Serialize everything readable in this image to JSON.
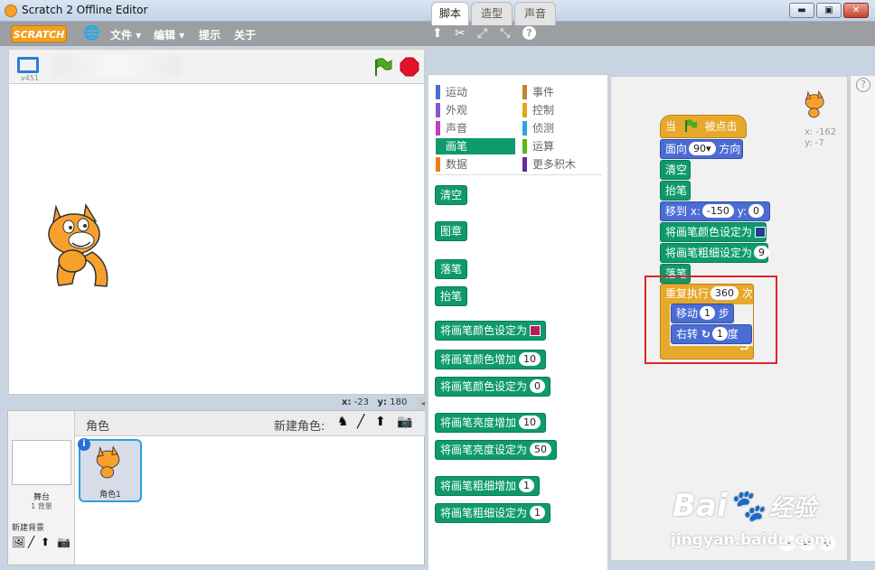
{
  "window": {
    "title": "Scratch 2 Offline Editor",
    "min": "▬",
    "max": "▣",
    "close": "✕"
  },
  "menu": {
    "logo": "SCRATCH",
    "file": "文件 ▾",
    "edit": "编辑 ▾",
    "tips": "提示",
    "about": "关于"
  },
  "toolbar": {
    "icons": [
      "duplicate-icon",
      "delete-icon",
      "grow-icon",
      "shrink-icon",
      "help-icon"
    ]
  },
  "stage": {
    "version": "v451",
    "coords_x_label": "x:",
    "coords_x": "-23",
    "coords_y_label": "y:",
    "coords_y": "180"
  },
  "sprites": {
    "header": "角色",
    "new_sprite": "新建角色:",
    "stage_label": "舞台",
    "stage_sub": "1 背景",
    "new_backdrop": "新建背景",
    "sprite1": "角色1",
    "info": "i"
  },
  "tabs": {
    "scripts": "脚本",
    "costumes": "造型",
    "sounds": "声音"
  },
  "categories": [
    {
      "label": "运动",
      "color": "#4a6cd4"
    },
    {
      "label": "事件",
      "color": "#c88330"
    },
    {
      "label": "外观",
      "color": "#8a55d7"
    },
    {
      "label": "控制",
      "color": "#e1a91a"
    },
    {
      "label": "声音",
      "color": "#bb42c3"
    },
    {
      "label": "侦测",
      "color": "#2ca5e2"
    },
    {
      "label": "画笔",
      "color": "#0e9a6c"
    },
    {
      "label": "运算",
      "color": "#5cb712"
    },
    {
      "label": "数据",
      "color": "#ee7d16"
    },
    {
      "label": "更多积木",
      "color": "#632d99"
    }
  ],
  "palette": [
    {
      "label": "清空"
    },
    {
      "label": "图章"
    },
    {
      "label": "落笔"
    },
    {
      "label": "抬笔"
    },
    {
      "label": "将画笔颜色设定为",
      "swatch": "#c0195a"
    },
    {
      "label": "将画笔颜色增加",
      "num": "10"
    },
    {
      "label": "将画笔颜色设定为",
      "num": "0"
    },
    {
      "label": "将画笔亮度增加",
      "num": "10"
    },
    {
      "label": "将画笔亮度设定为",
      "num": "50"
    },
    {
      "label": "将画笔粗细增加",
      "num": "1"
    },
    {
      "label": "将画笔粗细设定为",
      "num": "1"
    }
  ],
  "script": {
    "hat": "当",
    "hat2": "被点击",
    "point": "面向",
    "point_num": "90▾",
    "point_suffix": "方向",
    "clear": "清空",
    "penup": "抬笔",
    "goto": "移到 x:",
    "goto_x": "-150",
    "goto_y_label": "y:",
    "goto_y": "0",
    "setcolor": "将画笔颜色设定为",
    "swatch": "#1d3f8f",
    "setsize": "将画笔粗细设定为",
    "setsize_num": "9",
    "pendown": "落笔",
    "repeat": "重复执行",
    "repeat_num": "360",
    "repeat_suffix": "次",
    "move": "移动",
    "move_num": "1",
    "move_suffix": "步",
    "turn": "右转",
    "turn_num": "1",
    "turn_suffix": "度",
    "sprite_x": "x: -162",
    "sprite_y": "y: -7"
  },
  "watermark": {
    "brand": "Bai",
    "brand2": "经验",
    "url": "jingyan.baidu.com"
  }
}
